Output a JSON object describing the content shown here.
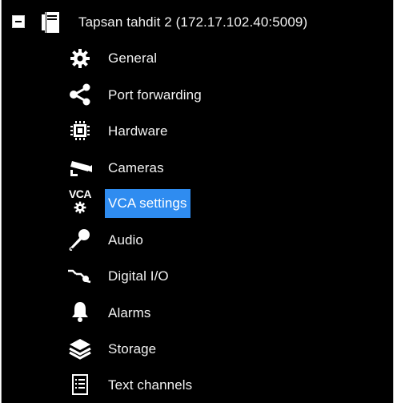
{
  "tree": {
    "server": {
      "name": "Tapsan tahdit 2 (172.17.102.40:5009)",
      "expanded": true,
      "icon": "server-icon"
    },
    "items": [
      {
        "label": "General",
        "icon": "gear-icon"
      },
      {
        "label": "Port forwarding",
        "icon": "share-icon"
      },
      {
        "label": "Hardware",
        "icon": "chip-icon"
      },
      {
        "label": "Cameras",
        "icon": "cctv-camera-icon"
      },
      {
        "label": "VCA settings",
        "icon": "vca-gear-icon",
        "selected": true
      },
      {
        "label": "Audio",
        "icon": "microphone-icon"
      },
      {
        "label": "Digital I/O",
        "icon": "digital-io-icon"
      },
      {
        "label": "Alarms",
        "icon": "bell-icon"
      },
      {
        "label": "Storage",
        "icon": "layers-icon"
      },
      {
        "label": "Text channels",
        "icon": "document-list-icon"
      }
    ],
    "vca_icon_text": "VCA"
  },
  "colors": {
    "background": "#000000",
    "text": "#f2f2f2",
    "selection": "#2f8cf0"
  }
}
